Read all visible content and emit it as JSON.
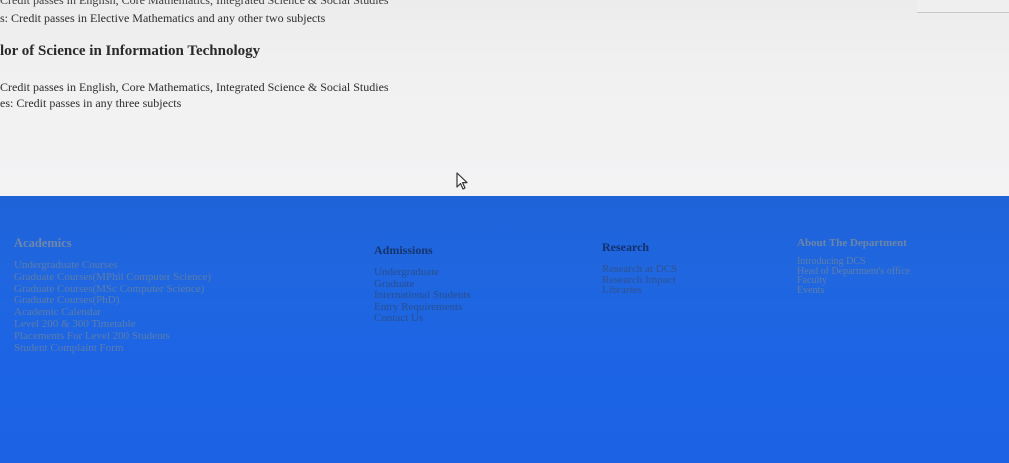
{
  "content": {
    "partial_top": "Credit passes in English, Core Mathematics, Integrated Science & Social Studies",
    "line1": "s: Credit passes in Elective Mathematics and any other two subjects",
    "degree_title": "lor of Science in Information Technology",
    "line2": "Credit passes in English, Core Mathematics, Integrated Science & Social Studies",
    "line3": "es: Credit passes in any three subjects"
  },
  "footer": {
    "academics": {
      "heading": "Academics",
      "links": [
        "Undergraduate Courses",
        "Graduate Courses(MPhil Computer Science)",
        "Graduate Courses(MSc Computer Science)",
        "Graduate Courses(PhD)",
        "Academic Calendar",
        "Level 200 & 300 Timetable",
        "Placements For Level 200 Students",
        "Student Complaint Form"
      ]
    },
    "admissions": {
      "heading": "Admissions",
      "links": [
        "Undergraduate",
        "Graduate",
        "International Students",
        "Entry Requirements",
        "Contact Us"
      ]
    },
    "research": {
      "heading": "Research",
      "links": [
        "Research at DCS",
        "Research Impact",
        "Libraries"
      ]
    },
    "about": {
      "heading": "About The Department",
      "links": [
        "Introducing DCS",
        "Head of Department's office",
        "Faculty",
        "Events"
      ]
    }
  }
}
